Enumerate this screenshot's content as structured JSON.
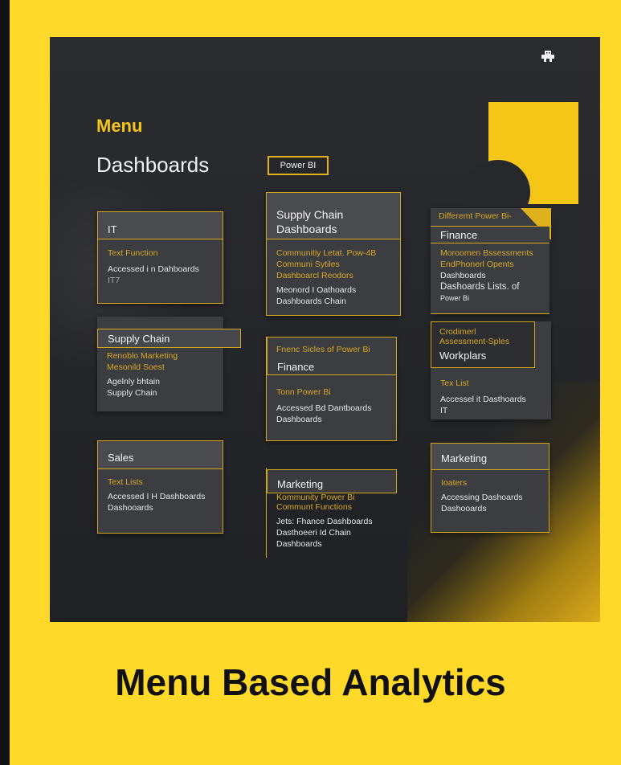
{
  "menu_label": "Menu",
  "dashboards_label": "Dashboards",
  "power_bi_tag": "Power BI",
  "cards": {
    "it": {
      "title": "IT",
      "lines": [
        "Text Function",
        "Accessed i n Dahboards",
        "IT7"
      ]
    },
    "supply_chain_dash": {
      "title": "Supply Chain Dashboards",
      "lines": [
        "Communitiy Letat. Pow-4B",
        "Communi Sytiles",
        "Dashboarcl Reodors",
        "Meonord I Oathoards",
        "Dashboards Chain"
      ]
    },
    "diff_finance": {
      "banner": "Differemt Power Bi-",
      "title": "Finance",
      "lines": [
        "Moroomen Bssessments",
        "EndPhonerl Opents",
        "Dashboards",
        "Dashoards Lists. of",
        "Power Bi"
      ]
    },
    "supply_chain": {
      "title": "Supply Chain",
      "lines": [
        "Renoblo Marketing",
        "Mesonild Soest",
        "Agelnly bhtain",
        "Supply Chain"
      ]
    },
    "finance": {
      "banner": "Fnenc Sicles of Power Bi",
      "title": "Finance",
      "lines": [
        "Tonn Power Bi",
        "Accessed Bd Dantboards",
        "Dashboards"
      ]
    },
    "workplars": {
      "banner": "Crodimerl Assessment-Sples",
      "title": "Workplars",
      "lines": [
        "Tex List",
        "Accessel it Dasthoards",
        "IT"
      ]
    },
    "sales": {
      "title": "Sales",
      "lines": [
        "Text Lists",
        "Accessed I H Dashboards",
        "Dashooards"
      ]
    },
    "marketing_mid": {
      "title": "Marketing",
      "lines": [
        "Kommunity Power Bi",
        "Communt Functions",
        "Jets: Fhance Dashboards",
        "Dasthoeeri Id Chain",
        "Dashboards"
      ]
    },
    "marketing_right": {
      "title": "Marketing",
      "lines": [
        "Ioaters",
        "Accessing Dashoards",
        "Dashooards"
      ]
    }
  },
  "footer_title": "Menu Based Analytics",
  "colors": {
    "accent": "#f5c518",
    "background": "#ffd92a",
    "panel": "#26282c"
  },
  "icons": {
    "top_right": "robot-icon"
  }
}
